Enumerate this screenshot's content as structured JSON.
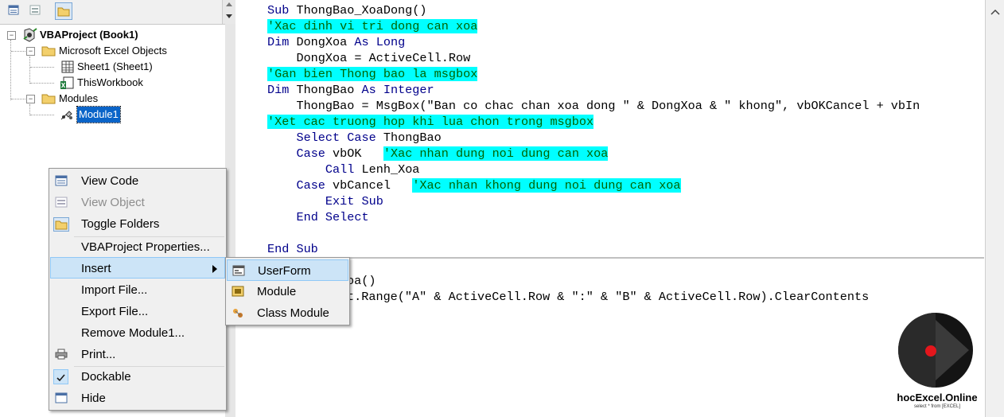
{
  "project_explorer": {
    "toolbar": {
      "view_code_icon": "module-icon",
      "view_object_icon": "form-icon",
      "toggle_folders_icon": "folder-icon"
    },
    "tree": {
      "root": "VBAProject (Book1)",
      "excel_objects_folder": "Microsoft Excel Objects",
      "sheet1": "Sheet1 (Sheet1)",
      "thisworkbook": "ThisWorkbook",
      "modules_folder": "Modules",
      "module1": "Module1"
    }
  },
  "code_window": {
    "lines": [
      "Sub ThongBao_XoaDong()",
      "'Xac dinh vi tri dong can xoa",
      "Dim DongXoa As Long",
      "    DongXoa = ActiveCell.Row",
      "'Gan bien Thong bao la msgbox",
      "Dim ThongBao As Integer",
      "    ThongBao = MsgBox(\"Ban co chac chan xoa dong \" & DongXoa & \" khong\", vbOKCancel + vbIn",
      "'Xet cac truong hop khi lua chon trong msgbox",
      "    Select Case ThongBao",
      "    Case vbOK   'Xac nhan dung noi dung can xoa",
      "        Call Lenh_Xoa",
      "    Case vbCancel   'Xac nhan khong dung noi dung can xoa",
      "        Exit Sub",
      "    End Select",
      "",
      "End Sub"
    ],
    "lower_lines": [
      "oa()",
      "t.Range(\"A\" & ActiveCell.Row & \":\" & \"B\" & ActiveCell.Row).ClearContents"
    ],
    "colors": {
      "keyword": "#00008b",
      "comment": "#006400",
      "highlight": "#00ffff"
    }
  },
  "context_menu": {
    "items": [
      {
        "label": "View Code",
        "icon": "view-code-icon",
        "enabled": true
      },
      {
        "label": "View Object",
        "icon": "view-object-icon",
        "enabled": false
      },
      {
        "label": "Toggle Folders",
        "icon": "folder-icon",
        "enabled": true
      },
      {
        "label": "VBAProject Properties...",
        "enabled": true
      },
      {
        "label": "Insert",
        "enabled": true,
        "submenu": true
      },
      {
        "label": "Import File...",
        "enabled": true
      },
      {
        "label": "Export File...",
        "enabled": true
      },
      {
        "label": "Remove Module1...",
        "enabled": true
      },
      {
        "label": "Print...",
        "icon": "printer-icon",
        "enabled": true
      },
      {
        "label": "Dockable",
        "icon": "check-icon",
        "checked": true,
        "enabled": true
      },
      {
        "label": "Hide",
        "icon": "hide-icon",
        "enabled": true
      }
    ],
    "insert_submenu": [
      {
        "label": "UserForm",
        "icon": "userform-icon"
      },
      {
        "label": "Module",
        "icon": "module-icon"
      },
      {
        "label": "Class Module",
        "icon": "class-module-icon"
      }
    ]
  },
  "logo": {
    "title": "hocExcel.Online",
    "tagline": "select * from [EXCEL]"
  }
}
